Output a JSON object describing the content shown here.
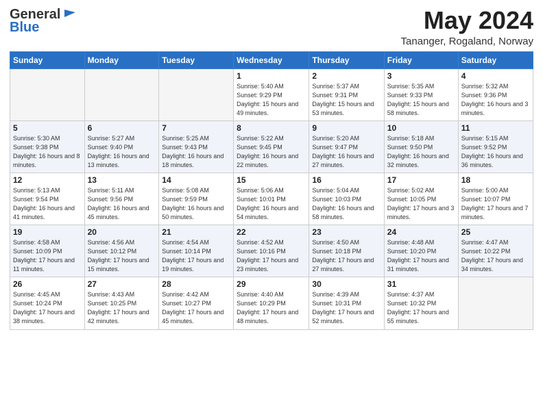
{
  "header": {
    "logo_general": "General",
    "logo_blue": "Blue",
    "title": "May 2024",
    "location": "Tananger, Rogaland, Norway"
  },
  "weekdays": [
    "Sunday",
    "Monday",
    "Tuesday",
    "Wednesday",
    "Thursday",
    "Friday",
    "Saturday"
  ],
  "weeks": [
    [
      {
        "day": "",
        "sunrise": "",
        "sunset": "",
        "daylight": "",
        "empty": true
      },
      {
        "day": "",
        "sunrise": "",
        "sunset": "",
        "daylight": "",
        "empty": true
      },
      {
        "day": "",
        "sunrise": "",
        "sunset": "",
        "daylight": "",
        "empty": true
      },
      {
        "day": "1",
        "sunrise": "Sunrise: 5:40 AM",
        "sunset": "Sunset: 9:29 PM",
        "daylight": "Daylight: 15 hours and 49 minutes."
      },
      {
        "day": "2",
        "sunrise": "Sunrise: 5:37 AM",
        "sunset": "Sunset: 9:31 PM",
        "daylight": "Daylight: 15 hours and 53 minutes."
      },
      {
        "day": "3",
        "sunrise": "Sunrise: 5:35 AM",
        "sunset": "Sunset: 9:33 PM",
        "daylight": "Daylight: 15 hours and 58 minutes."
      },
      {
        "day": "4",
        "sunrise": "Sunrise: 5:32 AM",
        "sunset": "Sunset: 9:36 PM",
        "daylight": "Daylight: 16 hours and 3 minutes."
      }
    ],
    [
      {
        "day": "5",
        "sunrise": "Sunrise: 5:30 AM",
        "sunset": "Sunset: 9:38 PM",
        "daylight": "Daylight: 16 hours and 8 minutes."
      },
      {
        "day": "6",
        "sunrise": "Sunrise: 5:27 AM",
        "sunset": "Sunset: 9:40 PM",
        "daylight": "Daylight: 16 hours and 13 minutes."
      },
      {
        "day": "7",
        "sunrise": "Sunrise: 5:25 AM",
        "sunset": "Sunset: 9:43 PM",
        "daylight": "Daylight: 16 hours and 18 minutes."
      },
      {
        "day": "8",
        "sunrise": "Sunrise: 5:22 AM",
        "sunset": "Sunset: 9:45 PM",
        "daylight": "Daylight: 16 hours and 22 minutes."
      },
      {
        "day": "9",
        "sunrise": "Sunrise: 5:20 AM",
        "sunset": "Sunset: 9:47 PM",
        "daylight": "Daylight: 16 hours and 27 minutes."
      },
      {
        "day": "10",
        "sunrise": "Sunrise: 5:18 AM",
        "sunset": "Sunset: 9:50 PM",
        "daylight": "Daylight: 16 hours and 32 minutes."
      },
      {
        "day": "11",
        "sunrise": "Sunrise: 5:15 AM",
        "sunset": "Sunset: 9:52 PM",
        "daylight": "Daylight: 16 hours and 36 minutes."
      }
    ],
    [
      {
        "day": "12",
        "sunrise": "Sunrise: 5:13 AM",
        "sunset": "Sunset: 9:54 PM",
        "daylight": "Daylight: 16 hours and 41 minutes."
      },
      {
        "day": "13",
        "sunrise": "Sunrise: 5:11 AM",
        "sunset": "Sunset: 9:56 PM",
        "daylight": "Daylight: 16 hours and 45 minutes."
      },
      {
        "day": "14",
        "sunrise": "Sunrise: 5:08 AM",
        "sunset": "Sunset: 9:59 PM",
        "daylight": "Daylight: 16 hours and 50 minutes."
      },
      {
        "day": "15",
        "sunrise": "Sunrise: 5:06 AM",
        "sunset": "Sunset: 10:01 PM",
        "daylight": "Daylight: 16 hours and 54 minutes."
      },
      {
        "day": "16",
        "sunrise": "Sunrise: 5:04 AM",
        "sunset": "Sunset: 10:03 PM",
        "daylight": "Daylight: 16 hours and 58 minutes."
      },
      {
        "day": "17",
        "sunrise": "Sunrise: 5:02 AM",
        "sunset": "Sunset: 10:05 PM",
        "daylight": "Daylight: 17 hours and 3 minutes."
      },
      {
        "day": "18",
        "sunrise": "Sunrise: 5:00 AM",
        "sunset": "Sunset: 10:07 PM",
        "daylight": "Daylight: 17 hours and 7 minutes."
      }
    ],
    [
      {
        "day": "19",
        "sunrise": "Sunrise: 4:58 AM",
        "sunset": "Sunset: 10:09 PM",
        "daylight": "Daylight: 17 hours and 11 minutes."
      },
      {
        "day": "20",
        "sunrise": "Sunrise: 4:56 AM",
        "sunset": "Sunset: 10:12 PM",
        "daylight": "Daylight: 17 hours and 15 minutes."
      },
      {
        "day": "21",
        "sunrise": "Sunrise: 4:54 AM",
        "sunset": "Sunset: 10:14 PM",
        "daylight": "Daylight: 17 hours and 19 minutes."
      },
      {
        "day": "22",
        "sunrise": "Sunrise: 4:52 AM",
        "sunset": "Sunset: 10:16 PM",
        "daylight": "Daylight: 17 hours and 23 minutes."
      },
      {
        "day": "23",
        "sunrise": "Sunrise: 4:50 AM",
        "sunset": "Sunset: 10:18 PM",
        "daylight": "Daylight: 17 hours and 27 minutes."
      },
      {
        "day": "24",
        "sunrise": "Sunrise: 4:48 AM",
        "sunset": "Sunset: 10:20 PM",
        "daylight": "Daylight: 17 hours and 31 minutes."
      },
      {
        "day": "25",
        "sunrise": "Sunrise: 4:47 AM",
        "sunset": "Sunset: 10:22 PM",
        "daylight": "Daylight: 17 hours and 34 minutes."
      }
    ],
    [
      {
        "day": "26",
        "sunrise": "Sunrise: 4:45 AM",
        "sunset": "Sunset: 10:24 PM",
        "daylight": "Daylight: 17 hours and 38 minutes."
      },
      {
        "day": "27",
        "sunrise": "Sunrise: 4:43 AM",
        "sunset": "Sunset: 10:25 PM",
        "daylight": "Daylight: 17 hours and 42 minutes."
      },
      {
        "day": "28",
        "sunrise": "Sunrise: 4:42 AM",
        "sunset": "Sunset: 10:27 PM",
        "daylight": "Daylight: 17 hours and 45 minutes."
      },
      {
        "day": "29",
        "sunrise": "Sunrise: 4:40 AM",
        "sunset": "Sunset: 10:29 PM",
        "daylight": "Daylight: 17 hours and 48 minutes."
      },
      {
        "day": "30",
        "sunrise": "Sunrise: 4:39 AM",
        "sunset": "Sunset: 10:31 PM",
        "daylight": "Daylight: 17 hours and 52 minutes."
      },
      {
        "day": "31",
        "sunrise": "Sunrise: 4:37 AM",
        "sunset": "Sunset: 10:32 PM",
        "daylight": "Daylight: 17 hours and 55 minutes."
      },
      {
        "day": "",
        "sunrise": "",
        "sunset": "",
        "daylight": "",
        "empty": true
      }
    ]
  ]
}
